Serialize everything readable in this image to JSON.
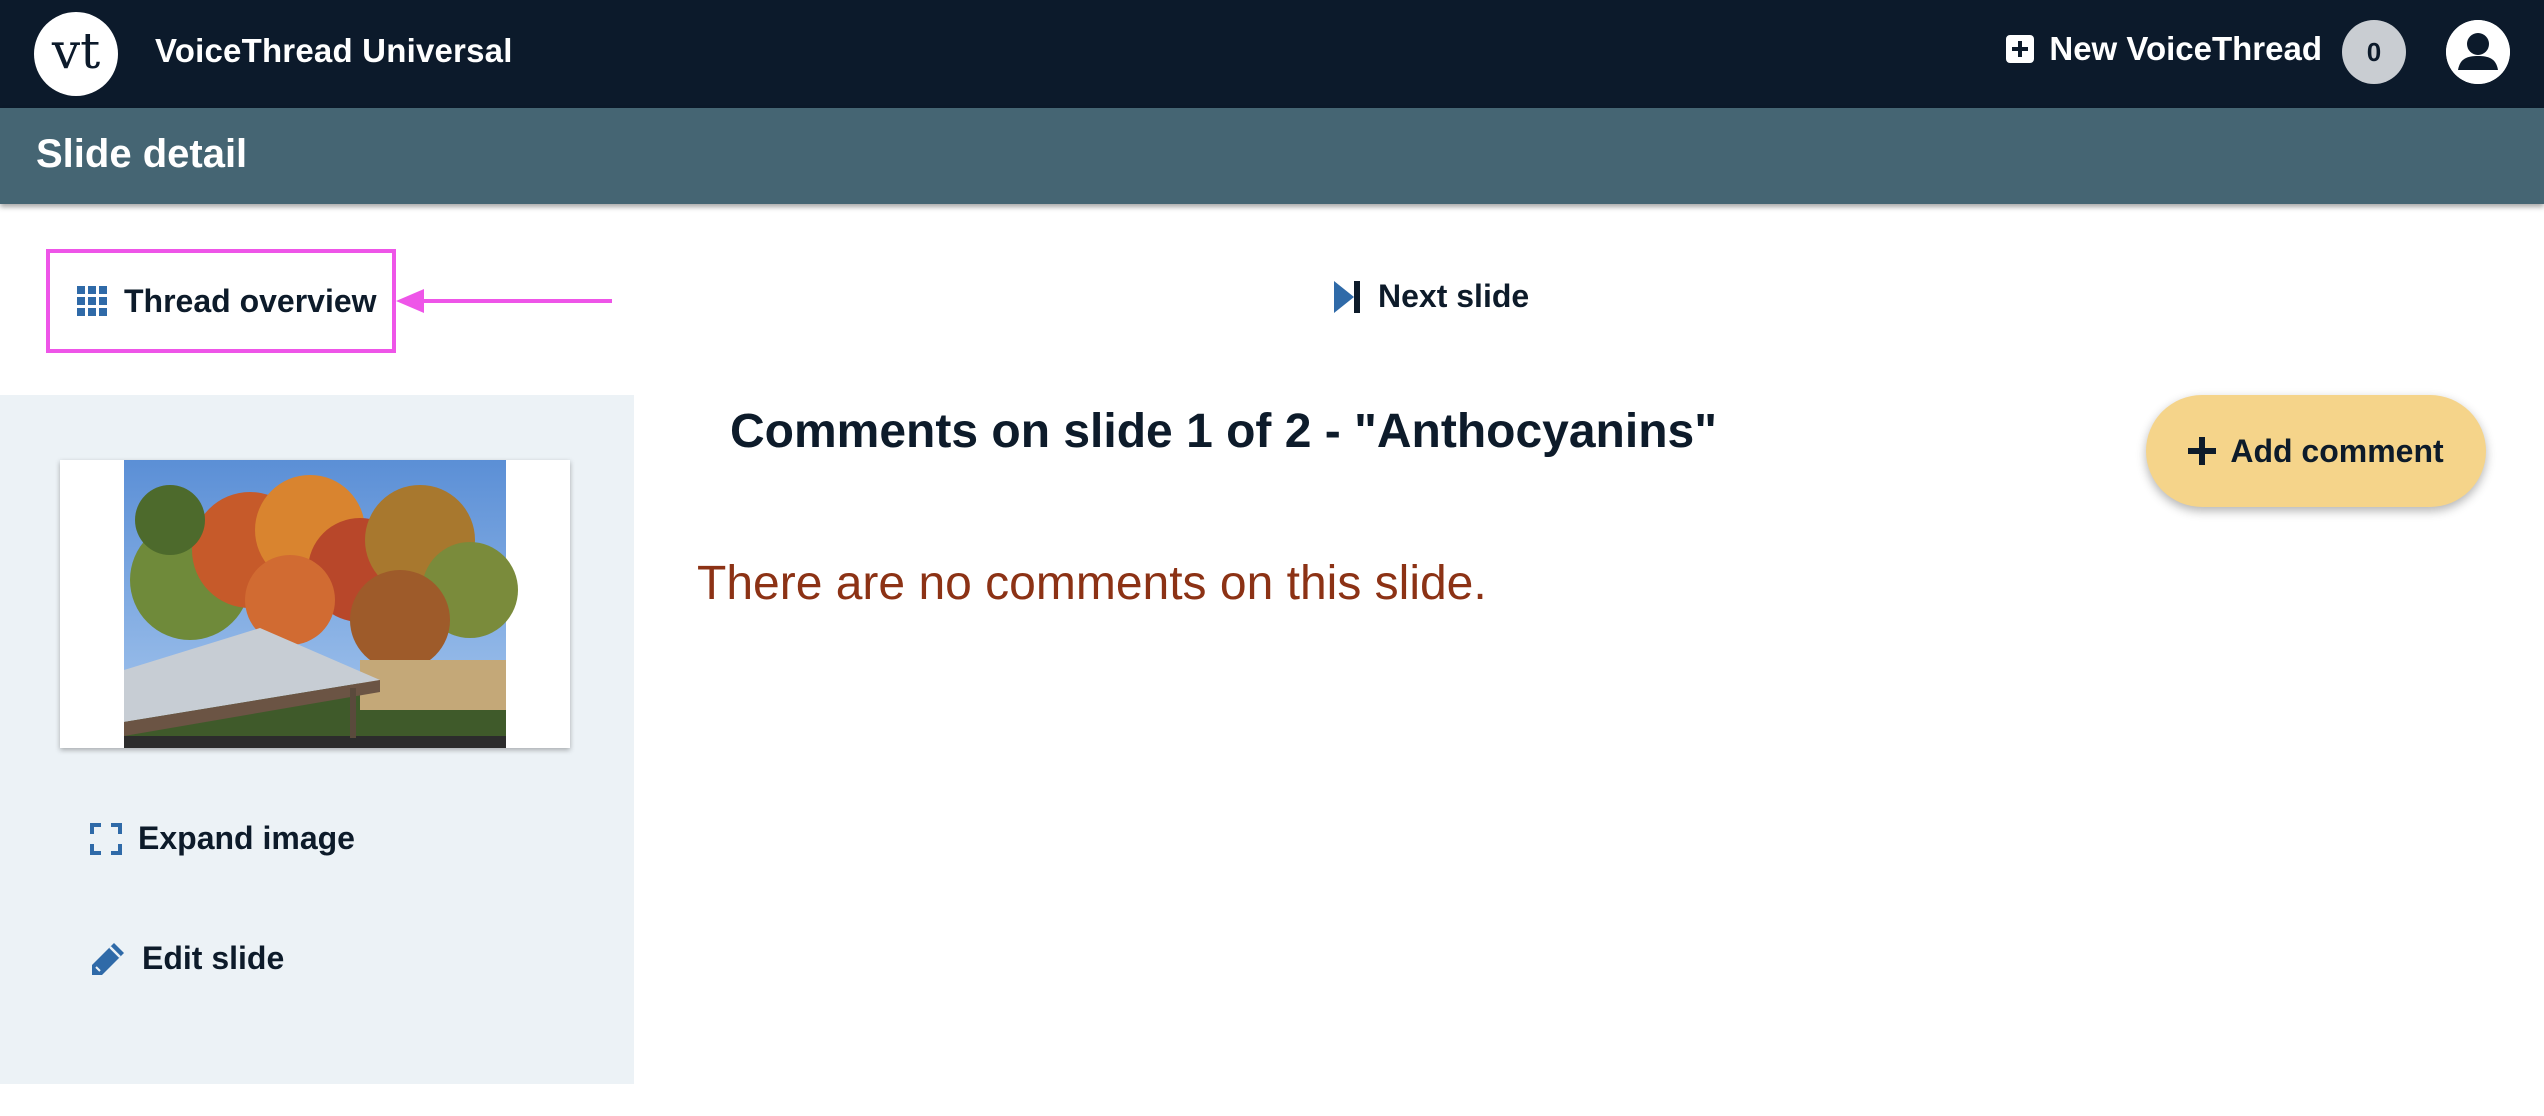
{
  "header": {
    "logo_text": "vt",
    "app_title": "VoiceThread Universal",
    "new_voicethread_label": "New VoiceThread",
    "notification_count": "0"
  },
  "subheader": {
    "title": "Slide detail"
  },
  "navigation": {
    "thread_overview_label": "Thread overview",
    "next_slide_label": "Next slide",
    "highlight_color": "#ee55e8"
  },
  "slide_panel": {
    "expand_image_label": "Expand image",
    "edit_slide_label": "Edit slide"
  },
  "comments": {
    "heading": "Comments on slide 1 of 2 - \"Anthocyanins\"",
    "empty_message": "There are no comments on this slide.",
    "add_comment_label": "Add comment"
  },
  "colors": {
    "topbar": "#0c1a2b",
    "subbar": "#456573",
    "side_panel": "#ecf2f6",
    "icon_blue": "#2f6aa8",
    "add_comment_bg": "#f5d48a",
    "empty_text": "#8c3215"
  },
  "icons": {
    "new_voicethread": "plus-square-icon",
    "thread_overview": "grid-icon",
    "next_slide": "skip-next-icon",
    "expand_image": "expand-icon",
    "edit_slide": "pencil-icon",
    "add_comment": "plus-icon",
    "account": "user-icon"
  }
}
